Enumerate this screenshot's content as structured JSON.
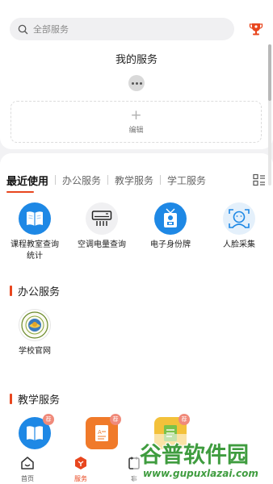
{
  "search": {
    "placeholder": "全部服务"
  },
  "my_services": {
    "title": "我的服务",
    "edit_label": "编辑"
  },
  "tabs": [
    {
      "label": "最近使用",
      "active": true
    },
    {
      "label": "办公服务",
      "active": false
    },
    {
      "label": "教学服务",
      "active": false
    },
    {
      "label": "学工服务",
      "active": false
    }
  ],
  "recent": [
    {
      "label_line1": "课程教室查询",
      "label_line2": "统计",
      "icon": "book-icon"
    },
    {
      "label_line1": "空调电量查询",
      "label_line2": "",
      "icon": "air-conditioner-icon"
    },
    {
      "label_line1": "电子身份牌",
      "label_line2": "",
      "icon": "id-badge-icon"
    },
    {
      "label_line1": "人脸采集",
      "label_line2": "",
      "icon": "face-scan-icon"
    }
  ],
  "office": {
    "title": "办公服务",
    "items": [
      {
        "label": "学校官网",
        "icon": "school-logo-icon"
      }
    ]
  },
  "teaching": {
    "title": "教学服务",
    "badge": "荐",
    "items": [
      {
        "icon": "book-icon"
      },
      {
        "icon": "document-icon"
      },
      {
        "icon": "notes-icon"
      }
    ]
  },
  "nav": [
    {
      "label": "首页",
      "icon": "home-icon",
      "active": false
    },
    {
      "label": "服务",
      "icon": "service-icon",
      "active": true
    },
    {
      "label": "事",
      "icon": "tasks-icon",
      "active": false
    }
  ],
  "watermark": {
    "title": "谷普软件园",
    "url": "www.gupuxlazai.com"
  },
  "colors": {
    "accent": "#e8461e",
    "blue": "#1e88e5",
    "orange": "#f07a2a",
    "watermark_green": "#3f9c3f"
  }
}
